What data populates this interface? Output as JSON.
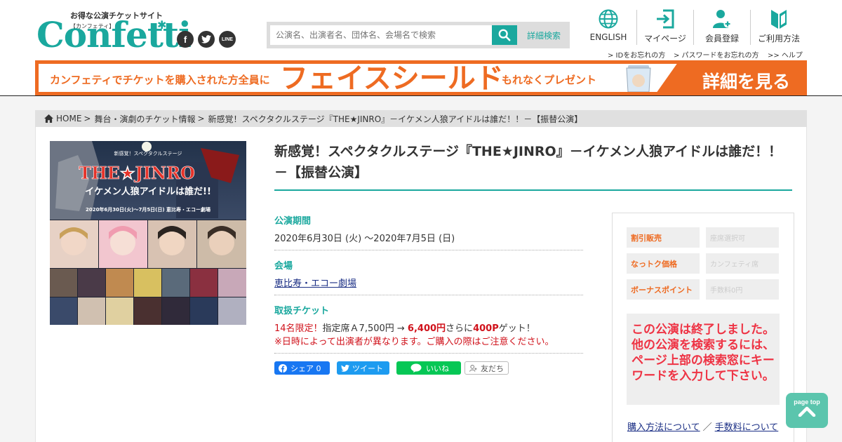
{
  "brand": {
    "tagline": "お得な公演チケットサイト",
    "subtitle": "【カンフェティ】",
    "name": "Confetti"
  },
  "social": {
    "facebook": "f",
    "line": "LINE"
  },
  "search": {
    "placeholder": "公演名、出演者名、団体名、会場名で検索",
    "advanced_label": "詳細検索"
  },
  "nav": [
    {
      "label": "ENGLISH",
      "icon": "globe-icon"
    },
    {
      "label": "マイページ",
      "icon": "login-icon"
    },
    {
      "label": "会員登録",
      "icon": "user-add-icon"
    },
    {
      "label": "ご利用方法",
      "icon": "beginner-mark-icon"
    }
  ],
  "sublinks": {
    "id_forgot": "> IDをお忘れの方",
    "pw_forgot": "> パスワードをお忘れの方",
    "help": ">> ヘルプ"
  },
  "banner": {
    "lead": "カンフェティでチケットを購入された方全員に",
    "headline": "フェイスシールド",
    "tail": "もれなくプレゼント",
    "cta": "詳細を見る"
  },
  "breadcrumb": [
    {
      "label": "HOME"
    },
    {
      "label": "舞台・演劇のチケット情報"
    },
    {
      "label": "新感覚！スペクタクルステージ『THE★JINRO』－イケメン人狼アイドルは誰だ！！－【振替公演】"
    }
  ],
  "event": {
    "title": "新感覚！スペクタクルステージ『THE★JINRO』－イケメン人狼アイドルは誰だ！！－【振替公演】",
    "poster": {
      "small_caption": "新感覚！スペクタクルステージ",
      "logo": "THE★JINRO",
      "tagline": "イケメン人狼アイドルは誰だ!!",
      "dates": "2020年6月30日(火)〜7月5日(日) 恵比寿・エコー劇場"
    },
    "period_label": "公演期間",
    "period_value": "2020年6月30日 (火) ～2020年7月5日 (日)",
    "venue_label": "会場",
    "venue_value": "恵比寿・エコー劇場",
    "tickets_label": "取扱チケット",
    "ticket_limit": "14名限定！",
    "ticket_seat": "指定席Ａ7,500円 → ",
    "ticket_price": "6,400円",
    "ticket_plus": "さらに",
    "ticket_points": "400P",
    "ticket_get": "ゲット！",
    "ticket_note": "※日時によって出演者が異なります。ご購入の際はご注意ください。"
  },
  "share": {
    "facebook": "シェア 0",
    "twitter": "ツイート",
    "line": "いいね",
    "friends": "友だち"
  },
  "side": {
    "rows": [
      {
        "label": "割引販売",
        "value": "座席選択可"
      },
      {
        "label": "なっトク価格",
        "value": "カンフェティ席"
      },
      {
        "label": "ボーナスポイント",
        "value": "手数料0円"
      }
    ],
    "ended_message": "この公演は終了しました。他の公演を検索するには、ページ上部の検索窓にキーワードを入力して下さい。",
    "purchase_link": "購入方法について",
    "fee_link": "手数料について"
  },
  "pagetop": "page top",
  "colors": {
    "brand_teal": "#1aa89e",
    "banner_orange": "#ee6b22",
    "alert_red": "#ee3344"
  }
}
